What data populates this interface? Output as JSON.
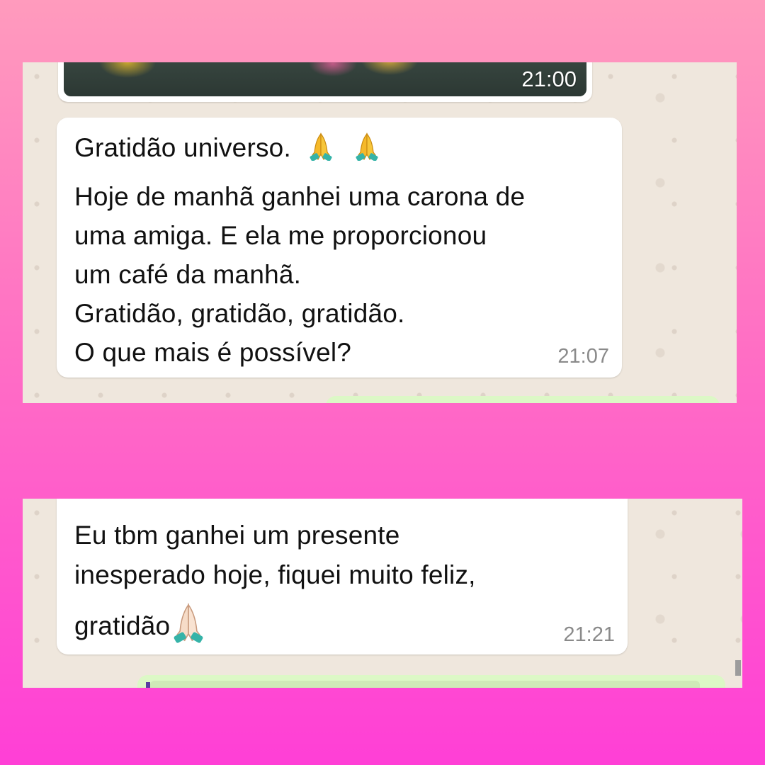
{
  "top_screenshot": {
    "photo_message": {
      "time": "21:00"
    },
    "text_message": {
      "lines": [
        "Gratidão universo.",
        "Hoje de manhã ganhei uma carona de",
        "uma amiga. E ela me proporcionou",
        "um café da manhã.",
        "Gratidão, gratidão, gratidão.",
        "O que mais é possível?"
      ],
      "emojis": [
        "🙏",
        "🙏"
      ],
      "time": "21:07"
    }
  },
  "bottom_screenshot": {
    "text_message": {
      "lines": [
        "Eu tbm ganhei um presente",
        "inesperado hoje, fiquei muito feliz,",
        "gratidão"
      ],
      "emoji": "🙏🏻",
      "time": "21:21"
    }
  },
  "colors": {
    "background_top": "#ff9bbd",
    "background_bottom": "#ff3fd6",
    "chat_wallpaper": "#efe7dd",
    "incoming_bubble": "#ffffff",
    "outgoing_bubble": "#dcf8c6",
    "timestamp": "#8a8a8a"
  }
}
